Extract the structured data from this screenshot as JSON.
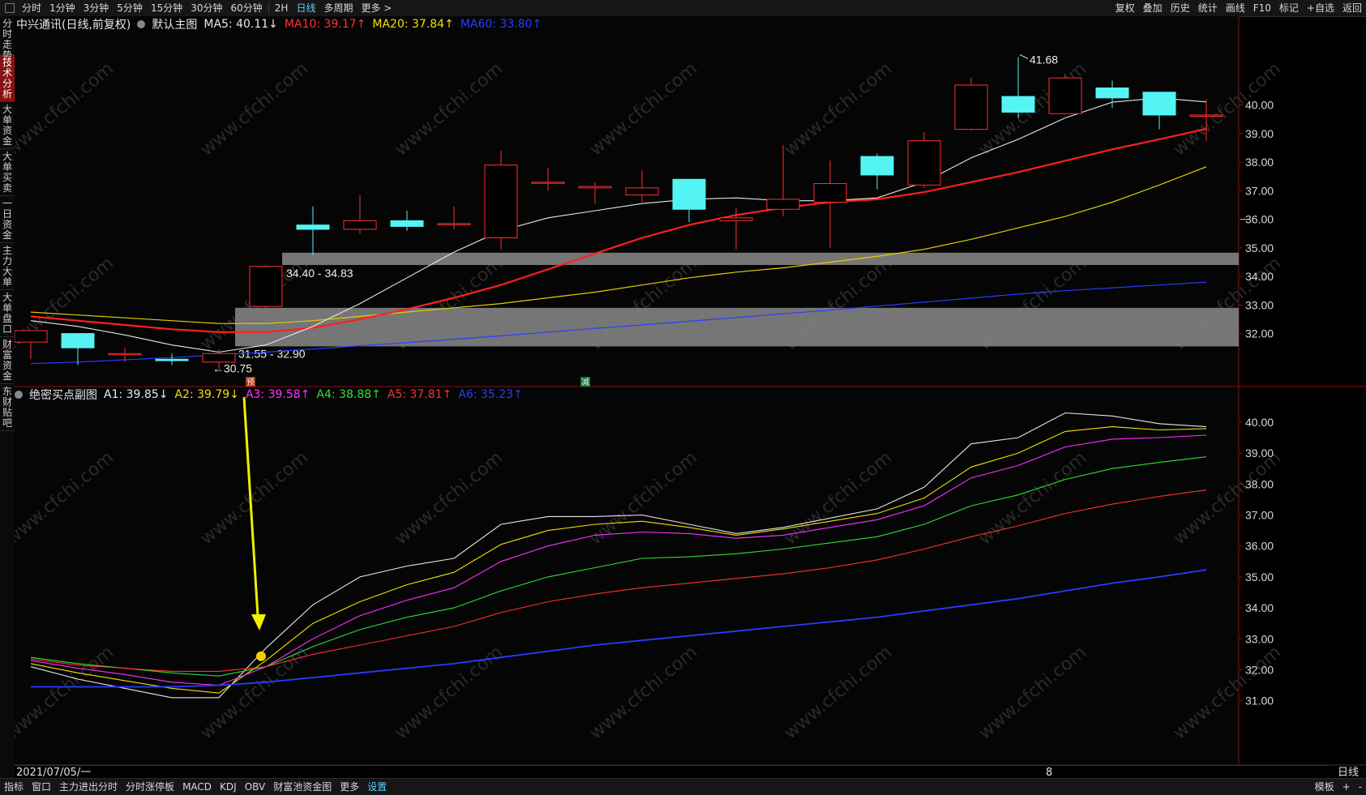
{
  "toolbar": {
    "periods": [
      "分时",
      "1分钟",
      "3分钟",
      "5分钟",
      "15分钟",
      "30分钟",
      "60分钟",
      "2H",
      "日线",
      "多周期",
      "更多 >"
    ],
    "active_period": "日线",
    "right_tools": [
      "复权",
      "叠加",
      "历史",
      "统计",
      "画线",
      "F10",
      "标记",
      "+自选",
      "返回"
    ]
  },
  "sidebar": {
    "items": [
      "分时走势",
      "技术分析",
      "大单资金",
      "大单买卖",
      "一日资金",
      "主力大单",
      "大单盘口",
      "财富资金",
      "东财贴吧"
    ],
    "active": "技术分析"
  },
  "main_legend": {
    "title": "中兴通讯(日线,前复权)",
    "preset": "默认主图",
    "items": [
      {
        "text": "MA5: 40.11↓",
        "color": "#e8e8e8"
      },
      {
        "text": "MA10: 39.17↑",
        "color": "#ff3030"
      },
      {
        "text": "MA20: 37.84↑",
        "color": "#f0e000"
      },
      {
        "text": "MA60: 33.80↑",
        "color": "#2a3cff"
      }
    ]
  },
  "sub_legend": {
    "title": "绝密买点副图",
    "items": [
      {
        "text": "A1: 39.85↓",
        "color": "#e8e8e8"
      },
      {
        "text": "A2: 39.79↓",
        "color": "#f0e000"
      },
      {
        "text": "A3: 39.58↑",
        "color": "#ff30ff"
      },
      {
        "text": "A4: 38.88↑",
        "color": "#30e030"
      },
      {
        "text": "A5: 37.81↑",
        "color": "#ff3030"
      },
      {
        "text": "A6: 35.23↑",
        "color": "#2a3cff"
      }
    ]
  },
  "chart_data": [
    {
      "type": "candlestick",
      "name": "main",
      "ylim": [
        30.2,
        42.6
      ],
      "y_ticks": [
        32,
        33,
        34,
        35,
        36,
        37,
        38,
        39,
        40
      ],
      "y_tick_labels": [
        "32.00",
        "33.00",
        "34.00",
        "35.00",
        "36.00",
        "37.00",
        "38.00",
        "39.00",
        "40.00"
      ],
      "candles": [
        {
          "o": 31.7,
          "h": 31.7,
          "l": 31.1,
          "c": 32.1
        },
        {
          "o": 32.0,
          "h": 32.0,
          "l": 30.9,
          "c": 31.5
        },
        {
          "o": 31.3,
          "h": 31.5,
          "l": 31.0,
          "c": 31.3
        },
        {
          "o": 31.1,
          "h": 31.3,
          "l": 30.9,
          "c": 31.05
        },
        {
          "o": 31.0,
          "h": 31.45,
          "l": 30.75,
          "c": 31.3
        },
        {
          "o": 32.95,
          "h": 34.4,
          "l": 32.8,
          "c": 34.35
        },
        {
          "o": 35.8,
          "h": 36.45,
          "l": 34.75,
          "c": 35.65
        },
        {
          "o": 35.65,
          "h": 36.85,
          "l": 35.5,
          "c": 35.95
        },
        {
          "o": 35.95,
          "h": 36.3,
          "l": 35.6,
          "c": 35.75
        },
        {
          "o": 35.85,
          "h": 36.45,
          "l": 35.65,
          "c": 35.85
        },
        {
          "o": 35.35,
          "h": 38.4,
          "l": 34.95,
          "c": 37.9
        },
        {
          "o": 37.3,
          "h": 37.8,
          "l": 37.0,
          "c": 37.3
        },
        {
          "o": 37.1,
          "h": 37.3,
          "l": 36.55,
          "c": 37.15
        },
        {
          "o": 36.85,
          "h": 37.7,
          "l": 36.6,
          "c": 37.1
        },
        {
          "o": 37.4,
          "h": 37.4,
          "l": 35.9,
          "c": 36.35
        },
        {
          "o": 35.95,
          "h": 36.4,
          "l": 34.95,
          "c": 36.05
        },
        {
          "o": 36.35,
          "h": 38.6,
          "l": 36.1,
          "c": 36.7
        },
        {
          "o": 36.6,
          "h": 38.05,
          "l": 35.0,
          "c": 37.25
        },
        {
          "o": 38.2,
          "h": 38.3,
          "l": 37.05,
          "c": 37.55
        },
        {
          "o": 37.2,
          "h": 39.05,
          "l": 37.1,
          "c": 38.75
        },
        {
          "o": 39.15,
          "h": 40.95,
          "l": 39.1,
          "c": 40.7
        },
        {
          "o": 40.3,
          "h": 41.68,
          "l": 39.55,
          "c": 39.75
        },
        {
          "o": 39.7,
          "h": 41.1,
          "l": 39.7,
          "c": 40.95
        },
        {
          "o": 40.6,
          "h": 40.85,
          "l": 39.9,
          "c": 40.25
        },
        {
          "o": 40.45,
          "h": 40.45,
          "l": 39.15,
          "c": 39.65
        },
        {
          "o": 39.65,
          "h": 40.2,
          "l": 38.75,
          "c": 39.65
        }
      ],
      "ma": {
        "MA5": [
          32.45,
          32.25,
          31.95,
          31.6,
          31.35,
          31.6,
          32.25,
          33.05,
          33.95,
          34.85,
          35.6,
          36.05,
          36.3,
          36.55,
          36.7,
          36.75,
          36.65,
          36.65,
          36.75,
          37.3,
          38.15,
          38.8,
          39.55,
          40.1,
          40.25,
          40.11
        ],
        "MA10": [
          32.6,
          32.45,
          32.3,
          32.15,
          32.05,
          32.05,
          32.2,
          32.5,
          32.85,
          33.25,
          33.7,
          34.25,
          34.8,
          35.35,
          35.8,
          36.15,
          36.4,
          36.6,
          36.7,
          36.95,
          37.3,
          37.65,
          38.05,
          38.45,
          38.8,
          39.17
        ],
        "MA20": [
          32.75,
          32.65,
          32.55,
          32.45,
          32.35,
          32.35,
          32.45,
          32.6,
          32.75,
          32.9,
          33.05,
          33.25,
          33.45,
          33.7,
          33.95,
          34.15,
          34.3,
          34.5,
          34.7,
          34.95,
          35.3,
          35.7,
          36.1,
          36.6,
          37.2,
          37.84
        ],
        "MA60": [
          30.95,
          31.0,
          31.08,
          31.16,
          31.25,
          31.35,
          31.46,
          31.57,
          31.68,
          31.8,
          31.92,
          32.05,
          32.18,
          32.3,
          32.43,
          32.56,
          32.69,
          32.82,
          32.96,
          33.1,
          33.24,
          33.38,
          33.5,
          33.6,
          33.7,
          33.8
        ]
      },
      "zones": [
        {
          "low": 34.4,
          "high": 34.83,
          "label": "34.40 - 34.83"
        },
        {
          "low": 31.55,
          "high": 32.9,
          "label": "31.55 - 32.90"
        }
      ],
      "annotations": [
        {
          "text": "41.68",
          "index": 21,
          "price": 41.68
        },
        {
          "text": "←30.75",
          "index": 4,
          "price": 30.75
        },
        {
          "text": "预",
          "index": 5
        },
        {
          "text": "减",
          "index": 12
        }
      ],
      "last_price_marker": 36.0
    },
    {
      "type": "line",
      "name": "sub",
      "ylim": [
        30.6,
        40.6
      ],
      "y_ticks": [
        31,
        32,
        33,
        34,
        35,
        36,
        37,
        38,
        39,
        40
      ],
      "y_tick_labels": [
        "31.00",
        "32.00",
        "33.00",
        "34.00",
        "35.00",
        "36.00",
        "37.00",
        "38.00",
        "39.00",
        "40.00"
      ],
      "series": [
        {
          "name": "A1",
          "color": "#e8e8e8",
          "values": [
            32.1,
            31.7,
            31.4,
            31.1,
            31.1,
            32.7,
            34.1,
            35.0,
            35.35,
            35.6,
            36.7,
            36.95,
            36.95,
            37.0,
            36.7,
            36.4,
            36.6,
            36.9,
            37.2,
            37.9,
            39.3,
            39.5,
            40.3,
            40.2,
            39.95,
            39.85
          ]
        },
        {
          "name": "A2",
          "color": "#f0e000",
          "values": [
            32.2,
            31.9,
            31.65,
            31.4,
            31.25,
            32.3,
            33.5,
            34.2,
            34.75,
            35.15,
            36.05,
            36.5,
            36.7,
            36.8,
            36.6,
            36.35,
            36.55,
            36.8,
            37.05,
            37.55,
            38.55,
            39.0,
            39.7,
            39.85,
            39.75,
            39.79
          ]
        },
        {
          "name": "A3",
          "color": "#ff30ff",
          "values": [
            32.3,
            32.05,
            31.85,
            31.6,
            31.5,
            32.1,
            33.0,
            33.75,
            34.25,
            34.65,
            35.5,
            36.0,
            36.35,
            36.45,
            36.4,
            36.25,
            36.35,
            36.6,
            36.85,
            37.3,
            38.2,
            38.6,
            39.2,
            39.45,
            39.5,
            39.58
          ]
        },
        {
          "name": "A4",
          "color": "#30e030",
          "values": [
            32.4,
            32.2,
            32.05,
            31.9,
            31.8,
            32.1,
            32.75,
            33.3,
            33.7,
            34.0,
            34.55,
            35.0,
            35.3,
            35.6,
            35.65,
            35.75,
            35.9,
            36.1,
            36.3,
            36.7,
            37.3,
            37.65,
            38.15,
            38.5,
            38.7,
            38.88
          ]
        },
        {
          "name": "A5",
          "color": "#ff3030",
          "values": [
            32.35,
            32.15,
            32.05,
            31.95,
            31.95,
            32.1,
            32.5,
            32.8,
            33.1,
            33.4,
            33.85,
            34.2,
            34.45,
            34.65,
            34.8,
            34.95,
            35.1,
            35.3,
            35.55,
            35.9,
            36.3,
            36.65,
            37.05,
            37.35,
            37.6,
            37.81
          ]
        },
        {
          "name": "A6",
          "color": "#2a3cff",
          "values": [
            31.45,
            31.45,
            31.45,
            31.45,
            31.5,
            31.6,
            31.75,
            31.9,
            32.05,
            32.2,
            32.4,
            32.6,
            32.8,
            32.95,
            33.1,
            33.25,
            33.4,
            33.55,
            33.7,
            33.9,
            34.1,
            34.3,
            34.55,
            34.8,
            35.0,
            35.23
          ]
        }
      ],
      "annotations": [
        {
          "text": "☺",
          "index": 5
        }
      ]
    }
  ],
  "xaxis": {
    "start_label": "2021/07/05/一",
    "mid_label": "8",
    "right_label": "日线"
  },
  "bottombar": {
    "items": [
      "指标",
      "窗口",
      "主力进出分时",
      "分时涨停板",
      "MACD",
      "KDJ",
      "OBV",
      "财富池资金图",
      "更多",
      "设置"
    ],
    "accent": "设置",
    "right": [
      "模板",
      "+",
      "-"
    ]
  },
  "watermark": "www.cfchi.com",
  "colors": {
    "up": "#ff3030",
    "down": "#54f4f4",
    "zone": "#808080",
    "arrow": "#f0f000"
  }
}
